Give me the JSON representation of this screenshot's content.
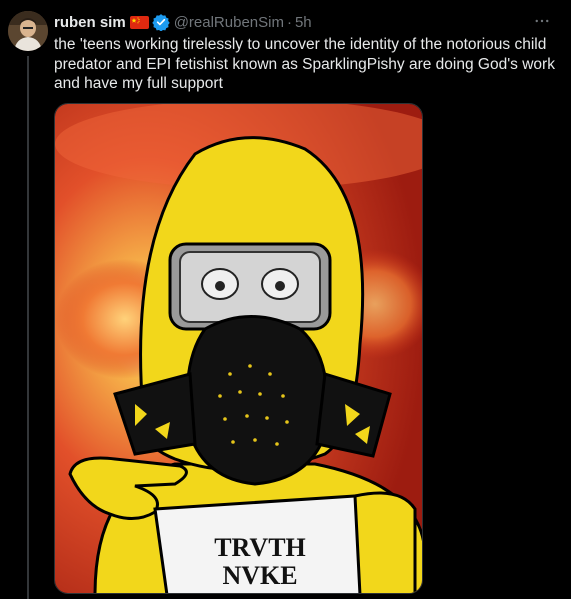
{
  "tweet": {
    "author_name": "ruben sim",
    "handle": "@realRubenSim",
    "separator": "·",
    "time": "5h",
    "more_icon": "more-horizontal-icon",
    "flag_icon": "china-flag-icon",
    "verified_icon": "verified-badge-icon",
    "text": "the 'teens working tirelessly to uncover the identity of the notorious child predator and EPI fetishist known as SparklingPishy are doing God's work and have my full support"
  },
  "media": {
    "sign_line1": "TRVTH",
    "sign_line2": "NVKE"
  },
  "colors": {
    "background": "#000000",
    "text": "#e7e9ea",
    "muted": "#71767b",
    "verified": "#1d9bf0",
    "yellow": "#f2d71b",
    "explosion": "#d8391c"
  }
}
